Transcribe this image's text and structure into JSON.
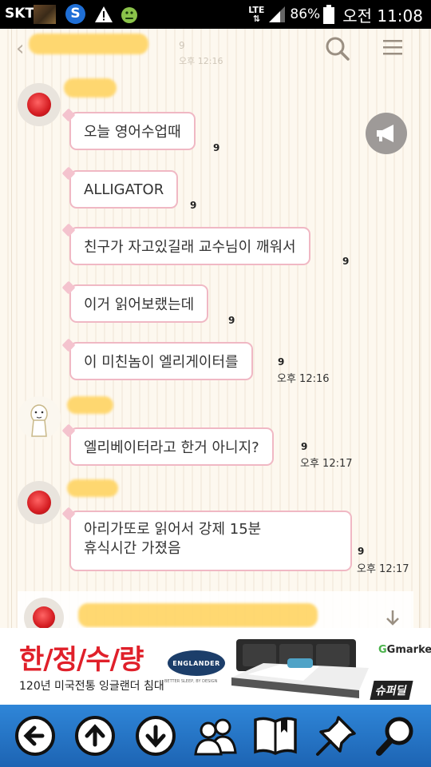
{
  "status_bar": {
    "carrier": "SKT",
    "network": "LTE",
    "battery": "86%",
    "time": "오전 11:08"
  },
  "chat_header": {
    "unread_count": "9",
    "faint_time": "오후 12:16"
  },
  "messages": [
    {
      "text": "오늘 영어수업때",
      "read_count": "9",
      "time": ""
    },
    {
      "text": "ALLIGATOR",
      "read_count": "9",
      "time": ""
    },
    {
      "text": "친구가 자고있길래 교수님이 깨워서",
      "read_count": "9",
      "time": ""
    },
    {
      "text": "이거 읽어보랬는데",
      "read_count": "9",
      "time": ""
    },
    {
      "text": "이 미친놈이 엘리게이터를",
      "read_count": "9",
      "time": "오후 12:16"
    },
    {
      "text": "엘리베이터라고 한거 아니지?",
      "read_count": "9",
      "time": "오후 12:17"
    },
    {
      "text_lines": [
        "아리가또로 읽어서 강제 15분",
        "휴식시간 가졌음"
      ],
      "read_count": "9",
      "time": "오후 12:17"
    }
  ],
  "ad": {
    "title": "한/정/수/량",
    "subtitle": "120년 미국전통 잉글랜더 침대",
    "brand": "ENGLANDER",
    "brand_tagline": "BETTER SLEEP, BY DESIGN",
    "market": "Gmarket",
    "badge": "슈퍼딜"
  },
  "icons": {
    "toolbar": [
      "back-arrow-icon",
      "up-arrow-icon",
      "down-arrow-icon",
      "users-icon",
      "book-icon",
      "pin-icon",
      "search-icon"
    ]
  },
  "colors": {
    "bubble_border": "#f0b8c4",
    "toolbar_blue": "#1d64b3",
    "ad_red": "#e0202a"
  }
}
